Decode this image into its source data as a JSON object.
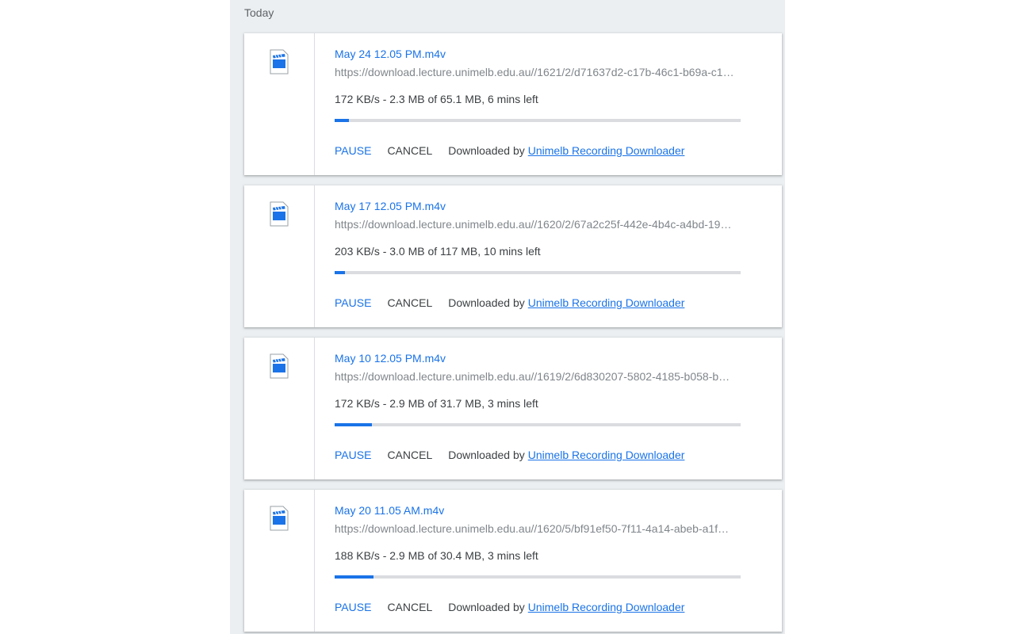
{
  "section": {
    "date_header": "Today"
  },
  "downloads": [
    {
      "file_name": "May 24 12.05 PM.m4v",
      "url": "https://download.lecture.unimelb.edu.au//1621/2/d71637d2-c17b-46c1-b69a-c1…",
      "status": "172 KB/s - 2.3 MB of 65.1 MB, 6 mins left",
      "progress": 0.035,
      "pause_label": "PAUSE",
      "cancel_label": "CANCEL",
      "byline": "Downloaded by",
      "extension_name": "Unimelb Recording Downloader",
      "icon": "video-file-icon"
    },
    {
      "file_name": "May 17 12.05 PM.m4v",
      "url": "https://download.lecture.unimelb.edu.au//1620/2/67a2c25f-442e-4b4c-a4bd-19…",
      "status": "203 KB/s - 3.0 MB of 117 MB, 10 mins left",
      "progress": 0.026,
      "pause_label": "PAUSE",
      "cancel_label": "CANCEL",
      "byline": "Downloaded by",
      "extension_name": "Unimelb Recording Downloader",
      "icon": "video-file-icon"
    },
    {
      "file_name": "May 10 12.05 PM.m4v",
      "url": "https://download.lecture.unimelb.edu.au//1619/2/6d830207-5802-4185-b058-b…",
      "status": "172 KB/s - 2.9 MB of 31.7 MB, 3 mins left",
      "progress": 0.091,
      "pause_label": "PAUSE",
      "cancel_label": "CANCEL",
      "byline": "Downloaded by",
      "extension_name": "Unimelb Recording Downloader",
      "icon": "video-file-icon"
    },
    {
      "file_name": "May 20 11.05 AM.m4v",
      "url": "https://download.lecture.unimelb.edu.au//1620/5/bf91ef50-7f11-4a14-abeb-a1f…",
      "status": "188 KB/s - 2.9 MB of 30.4 MB, 3 mins left",
      "progress": 0.095,
      "pause_label": "PAUSE",
      "cancel_label": "CANCEL",
      "byline": "Downloaded by",
      "extension_name": "Unimelb Recording Downloader",
      "icon": "video-file-icon"
    }
  ],
  "colors": {
    "accent": "#1a73e8",
    "background": "#eceff1",
    "progress_track": "#dadce0"
  }
}
